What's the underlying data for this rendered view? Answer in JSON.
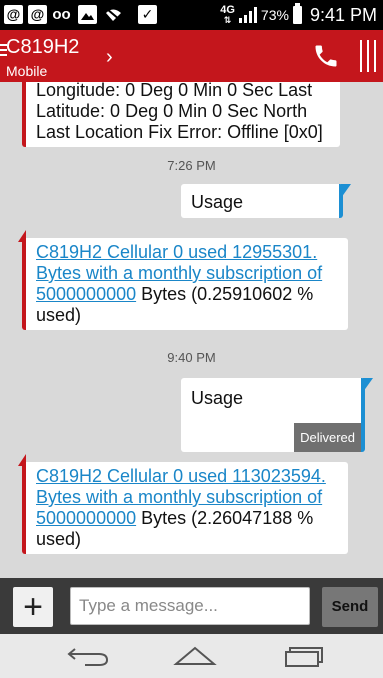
{
  "status_bar": {
    "icons": [
      {
        "name": "at-icon",
        "glyph": "@"
      },
      {
        "name": "at-icon-2",
        "glyph": "@"
      },
      {
        "name": "voicemail-icon",
        "glyph": "oo"
      },
      {
        "name": "image-icon",
        "glyph": ""
      },
      {
        "name": "wifi-off-icon",
        "glyph": ""
      },
      {
        "name": "clipboard-check-icon",
        "glyph": "✓"
      }
    ],
    "network": "4G",
    "battery_percent": "73%",
    "time": "9:41 PM"
  },
  "app_bar": {
    "title": "C819H2",
    "subtitle": "Mobile",
    "chevron": "›"
  },
  "thread": {
    "messages": [
      {
        "direction": "in",
        "text": "Longitude: 0 Deg 0 Min 0 Sec Last Latitude: 0 Deg 0 Min 0 Sec North Last Location Fix Error: Offline [0x0]"
      },
      {
        "direction": "stamp",
        "text": "7:26 PM"
      },
      {
        "direction": "out",
        "text": "Usage"
      },
      {
        "direction": "in",
        "link": "C819H2 Cellular 0 used 12955301. Bytes with a monthly subscription of 5000000000",
        "text": " Bytes  (0.25910602 % used)"
      },
      {
        "direction": "stamp",
        "text": "9:40 PM"
      },
      {
        "direction": "out",
        "text": "Usage",
        "status": "Delivered"
      },
      {
        "direction": "in",
        "link": "C819H2 Cellular 0 used 113023594. Bytes with a monthly subscription of 5000000000",
        "text": " Bytes  (2.26047188 % used)"
      }
    ]
  },
  "compose": {
    "plus": "+",
    "placeholder": "Type a message...",
    "send_label": "Send"
  },
  "colors": {
    "brand_red": "#c4161c",
    "outgoing_blue": "#1c8fd3",
    "link_blue": "#1a86c8"
  }
}
